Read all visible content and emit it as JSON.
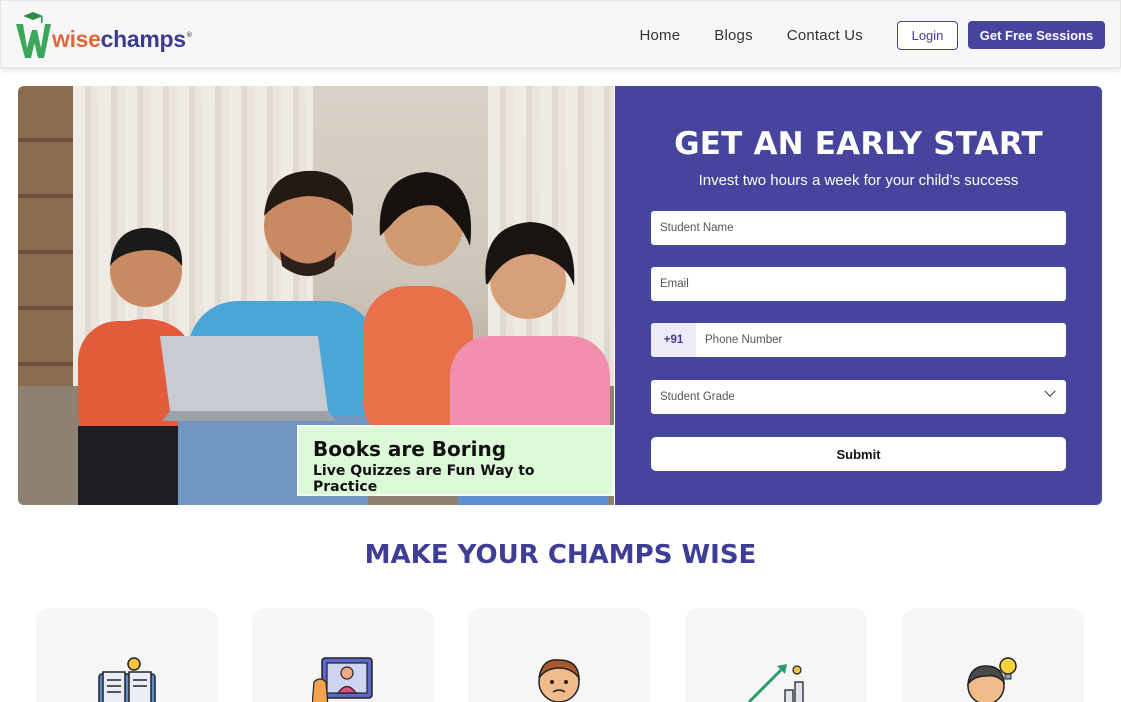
{
  "header": {
    "logo_part1": "wise",
    "logo_part2": "champs",
    "logo_reg": "®",
    "nav": [
      {
        "label": "Home"
      },
      {
        "label": "Blogs"
      },
      {
        "label": "Contact Us"
      }
    ],
    "login_label": "Login",
    "cta_label": "Get Free Sessions"
  },
  "hero": {
    "caption_title": "Books are Boring",
    "caption_sub": "Live Quizzes are Fun Way to Practice",
    "form": {
      "title": "GET AN EARLY START",
      "subtitle": "Invest two hours a week for your child’s success",
      "name_placeholder": "Student Name",
      "email_placeholder": "Email",
      "phone_code": "+91",
      "phone_placeholder": "Phone Number",
      "grade_placeholder": "Student Grade",
      "submit_label": "Submit"
    }
  },
  "section": {
    "title": "MAKE YOUR CHAMPS WISE",
    "cards": [
      {
        "icon": "book-idea-icon"
      },
      {
        "icon": "online-tutor-icon"
      },
      {
        "icon": "thinking-kid-icon"
      },
      {
        "icon": "growth-chart-icon"
      },
      {
        "icon": "idea-kid-icon"
      }
    ]
  },
  "colors": {
    "brand_primary": "#46449c",
    "brand_orange": "#e2673f",
    "brand_green": "#3aa85a",
    "caption_bg": "#dcf9d8"
  }
}
